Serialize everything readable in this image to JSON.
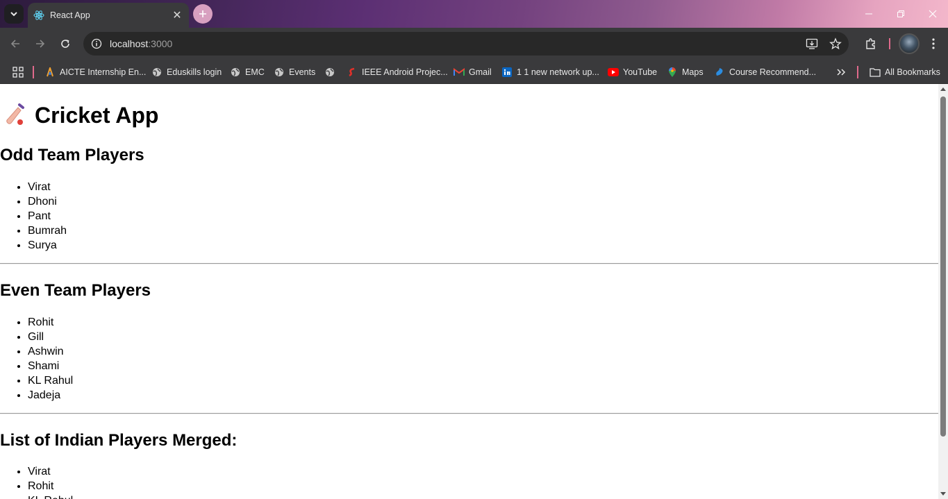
{
  "browser": {
    "tab_title": "React App",
    "url_host": "localhost",
    "url_port": ":3000",
    "bookmarks": [
      {
        "label": "AICTE Internship En...",
        "icon": "aicte-icon"
      },
      {
        "label": "Eduskills login",
        "icon": "globe-icon"
      },
      {
        "label": "EMC",
        "icon": "globe-icon"
      },
      {
        "label": "Events",
        "icon": "globe-icon"
      },
      {
        "label": "",
        "icon": "globe-icon"
      },
      {
        "label": "IEEE Android Projec...",
        "icon": "ieee-icon"
      },
      {
        "label": "Gmail",
        "icon": "gmail-icon"
      },
      {
        "label": "1 1 new network up...",
        "icon": "linkedin-icon"
      },
      {
        "label": "YouTube",
        "icon": "youtube-icon"
      },
      {
        "label": "Maps",
        "icon": "maps-icon"
      },
      {
        "label": "Course Recommend...",
        "icon": "course-icon"
      }
    ],
    "all_bookmarks_label": "All Bookmarks"
  },
  "page": {
    "title": "Cricket App",
    "odd_heading": "Odd Team Players",
    "odd_players": [
      "Virat",
      "Dhoni",
      "Pant",
      "Bumrah",
      "Surya"
    ],
    "even_heading": "Even Team Players",
    "even_players": [
      "Rohit",
      "Gill",
      "Ashwin",
      "Shami",
      "KL Rahul",
      "Jadeja"
    ],
    "merged_heading": "List of Indian Players Merged:",
    "merged_players": [
      "Virat",
      "Rohit",
      "KL Rahul"
    ]
  }
}
